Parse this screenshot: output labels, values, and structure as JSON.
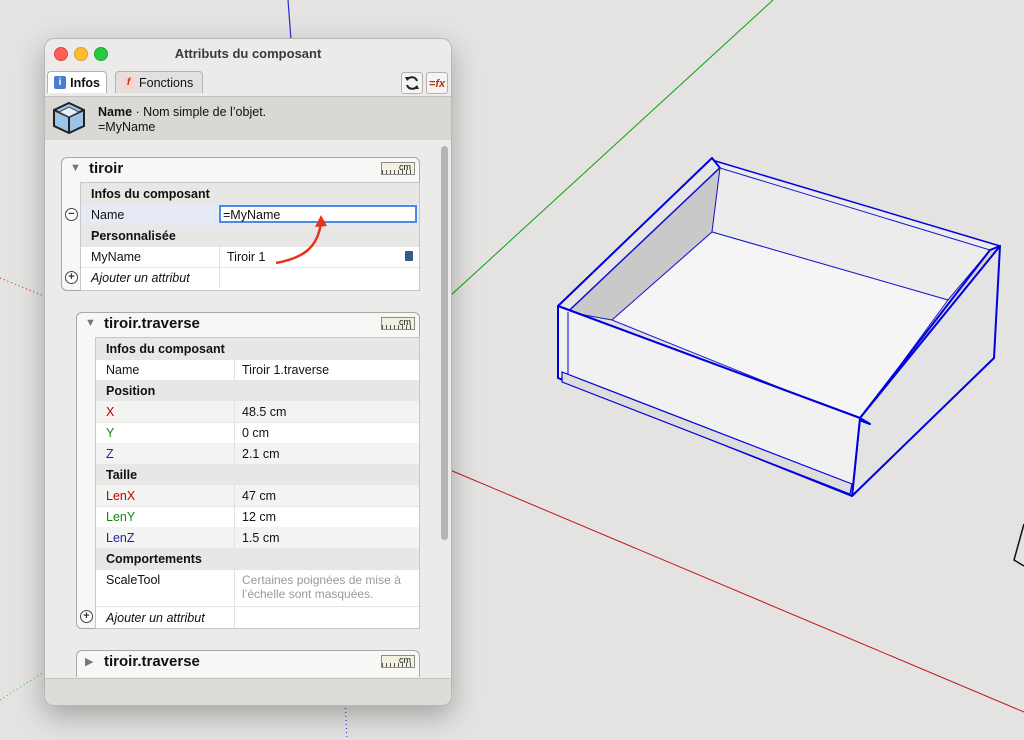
{
  "window": {
    "title": "Attributs du composant",
    "tabs": [
      "Infos",
      "Fonctions"
    ],
    "header": {
      "name_label": "Name",
      "name_desc": "· Nom simple de l’objet.",
      "value": "=MyName"
    }
  },
  "unit_badge": "cm",
  "comp1": {
    "name": "tiroir",
    "section1": "Infos du composant",
    "name_label": "Name",
    "name_value": "=MyName",
    "section2": "Personnalisée",
    "custom_label": "MyName",
    "custom_value": "Tiroir 1",
    "add_attr": "Ajouter un attribut"
  },
  "comp2": {
    "name": "tiroir.traverse",
    "section_info": "Infos du composant",
    "name_label": "Name",
    "name_value": "Tiroir 1.traverse",
    "section_pos": "Position",
    "x_label": "X",
    "x_value": "48.5 cm",
    "y_label": "Y",
    "y_value": "0 cm",
    "z_label": "Z",
    "z_value": "2.1 cm",
    "section_size": "Taille",
    "lenx_label": "LenX",
    "lenx_value": "47 cm",
    "leny_label": "LenY",
    "leny_value": "12 cm",
    "lenz_label": "LenZ",
    "lenz_value": "1.5 cm",
    "section_behav": "Comportements",
    "scale_label": "ScaleTool",
    "scale_value": "Certaines poignées de mise à l’échelle sont masquées.",
    "add_attr": "Ajouter un attribut"
  },
  "comp3": {
    "name": "tiroir.traverse"
  },
  "colors": {
    "x_axis": "#c00000",
    "y_axis": "#118a11",
    "z_axis": "#1f1fb0",
    "selection": "#0000dd",
    "arrow": "#e8341c"
  },
  "icons": [
    "info-icon",
    "functions-icon",
    "refresh-icon",
    "fx-icon",
    "component-cube-icon",
    "ruler-cm-icon",
    "collapse-triangle-icon",
    "minus-circle-icon",
    "plus-circle-icon",
    "calculator-icon"
  ]
}
